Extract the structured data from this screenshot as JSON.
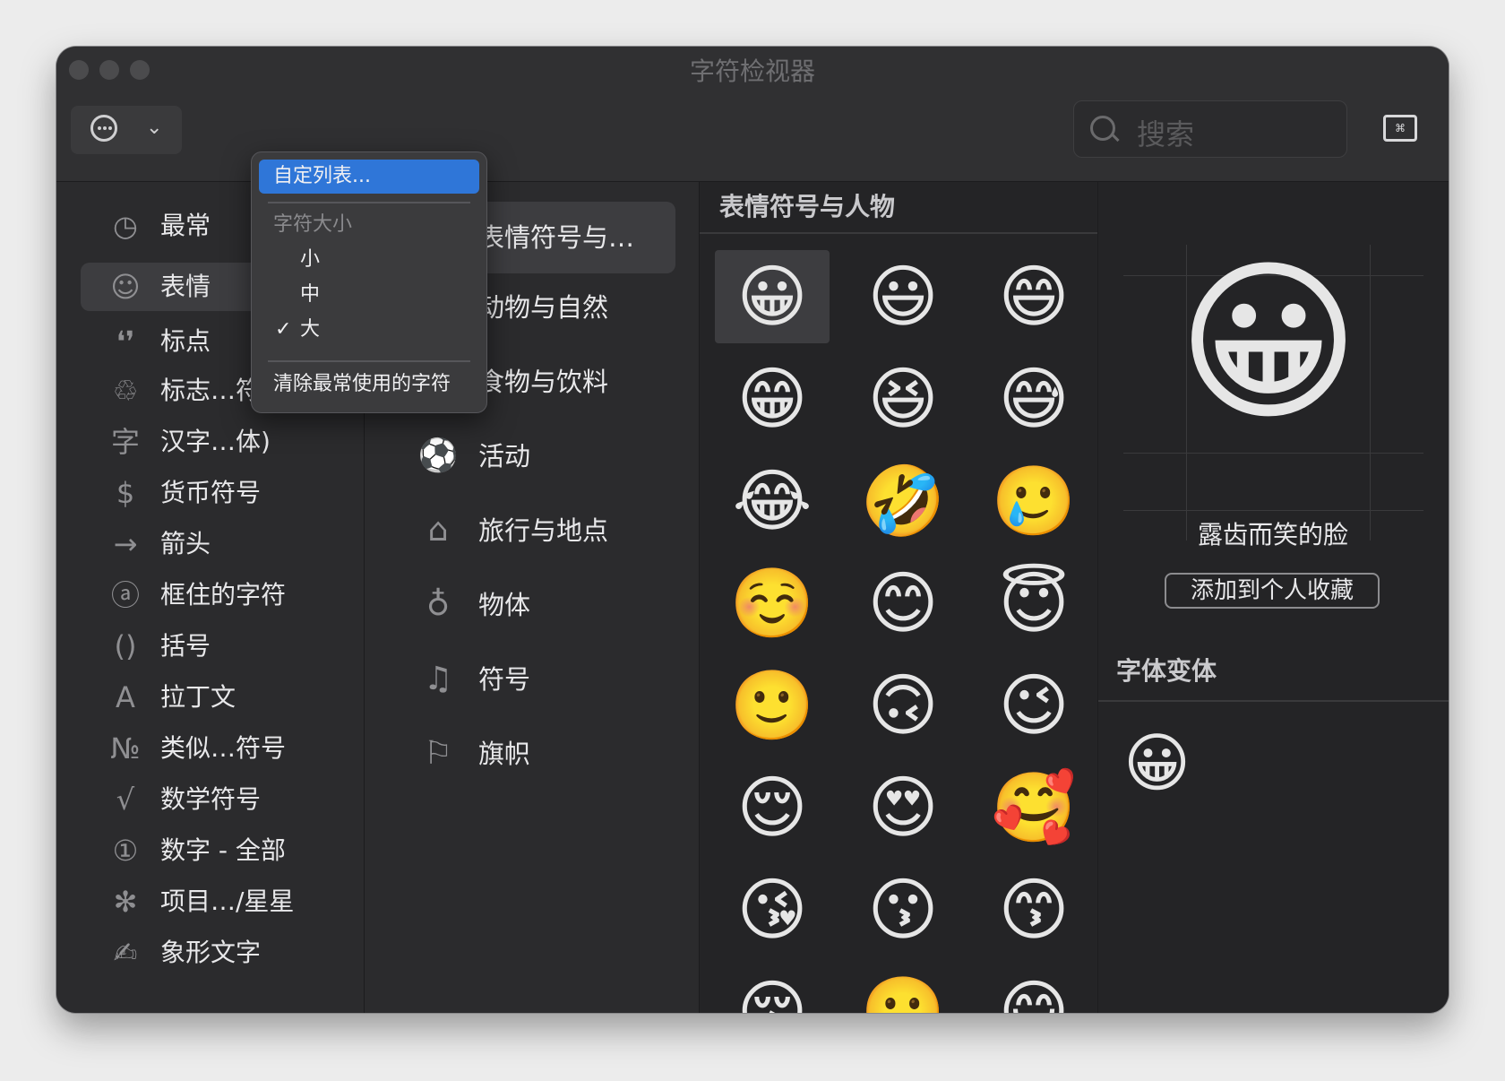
{
  "window": {
    "title": "字符检视器"
  },
  "toolbar": {
    "action_button_icon": "ellipsis-circle-icon",
    "dropdown_icon": "chevron-down-icon",
    "search_placeholder": "搜索",
    "keyboard_viewer_icon": "keyboard-icon"
  },
  "menu": {
    "customize_label": "自定列表...",
    "size_header": "字符大小",
    "size_options": [
      "小",
      "中",
      "大"
    ],
    "selected_size": "大",
    "check_mark": "✓",
    "clear_recent_label": "清除最常使用的字符"
  },
  "sidebar": {
    "items": [
      {
        "icon": "clock-icon",
        "glyph": "◷",
        "label": "最常"
      },
      {
        "icon": "smiley-icon",
        "glyph": "☺",
        "label": "表情"
      },
      {
        "icon": "punctuation-icon",
        "glyph": "❛❜",
        "label": "标点"
      },
      {
        "icon": "recycle-icon",
        "glyph": "♲",
        "label": "标志…符号"
      },
      {
        "icon": "han-character-icon",
        "glyph": "字",
        "label": "汉字…体)"
      },
      {
        "icon": "dollar-icon",
        "glyph": "$",
        "label": "货币符号"
      },
      {
        "icon": "arrow-icon",
        "glyph": "→",
        "label": "箭头"
      },
      {
        "icon": "circled-a-icon",
        "glyph": "ⓐ",
        "label": "框住的字符"
      },
      {
        "icon": "parentheses-icon",
        "glyph": "()",
        "label": "括号"
      },
      {
        "icon": "latin-a-icon",
        "glyph": "A",
        "label": "拉丁文"
      },
      {
        "icon": "numero-icon",
        "glyph": "№",
        "label": "类似…符号"
      },
      {
        "icon": "square-root-icon",
        "glyph": "√",
        "label": "数学符号"
      },
      {
        "icon": "circled-one-icon",
        "glyph": "①",
        "label": "数字 - 全部"
      },
      {
        "icon": "asterisk-icon",
        "glyph": "✻",
        "label": "项目…/星星"
      },
      {
        "icon": "pictograph-icon",
        "glyph": "✍",
        "label": "象形文字"
      }
    ]
  },
  "categories": {
    "items": [
      {
        "icon": "smiley-icon",
        "glyph": "☺",
        "label": "表情符号与…"
      },
      {
        "icon": "bear-icon",
        "glyph": "ʕ",
        "label": "动物与自然"
      },
      {
        "icon": "food-icon",
        "glyph": "⌸",
        "label": "食物与饮料"
      },
      {
        "icon": "soccer-ball-icon",
        "glyph": "⚽",
        "label": "活动"
      },
      {
        "icon": "building-icon",
        "glyph": "⌂",
        "label": "旅行与地点"
      },
      {
        "icon": "lightbulb-icon",
        "glyph": "♁",
        "label": "物体"
      },
      {
        "icon": "symbols-icon",
        "glyph": "♫",
        "label": "符号"
      },
      {
        "icon": "flag-icon",
        "glyph": "⚐",
        "label": "旗帜"
      }
    ]
  },
  "grid": {
    "header": "表情符号与人物",
    "emojis": [
      "😀",
      "😃",
      "😄",
      "😁",
      "😆",
      "😅",
      "😂",
      "🤣",
      "🥲",
      "☺️",
      "😊",
      "😇",
      "🙂",
      "🙃",
      "😉",
      "😌",
      "😍",
      "🥰",
      "😘",
      "😗",
      "😙",
      "😚",
      "🙂",
      "😋"
    ]
  },
  "detail": {
    "emoji": "😀",
    "name": "露齿而笑的脸",
    "favorite_button": "添加到个人收藏",
    "variants_header": "字体变体",
    "variant_emoji": "😀"
  }
}
